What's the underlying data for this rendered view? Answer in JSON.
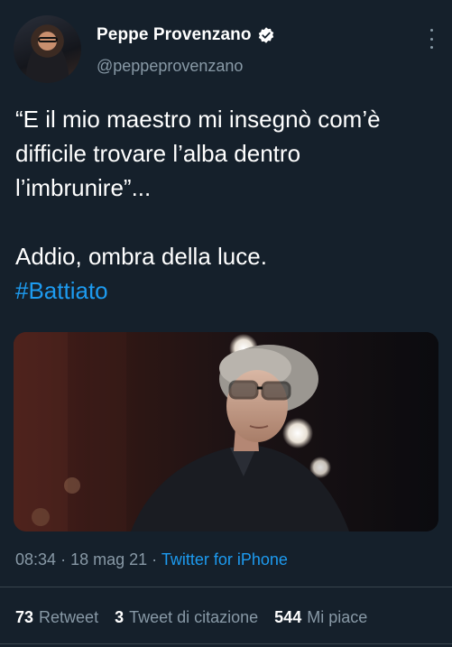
{
  "author": {
    "display_name": "Peppe Provenzano",
    "handle": "@peppeprovenzano",
    "verified": true
  },
  "icons": {
    "verified": "verified-badge-icon",
    "more": "more-vertical-icon"
  },
  "tweet": {
    "text": "“E il mio maestro mi insegnò com’è difficile trovare l’alba dentro l’imbrunire”...\n\nAddio, ombra della luce.",
    "hashtag": "#Battiato"
  },
  "meta": {
    "time": "08:34",
    "date": "18 mag 21",
    "separator": "·",
    "source": "Twitter for iPhone"
  },
  "stats": {
    "retweets_count": "73",
    "retweets_label": "Retweet",
    "quotes_count": "3",
    "quotes_label": "Tweet di citazione",
    "likes_count": "544",
    "likes_label": "Mi piace"
  },
  "colors": {
    "background": "#15202b",
    "accent": "#1d9bf0",
    "secondary_text": "#8899a6",
    "divider": "#38444d"
  }
}
